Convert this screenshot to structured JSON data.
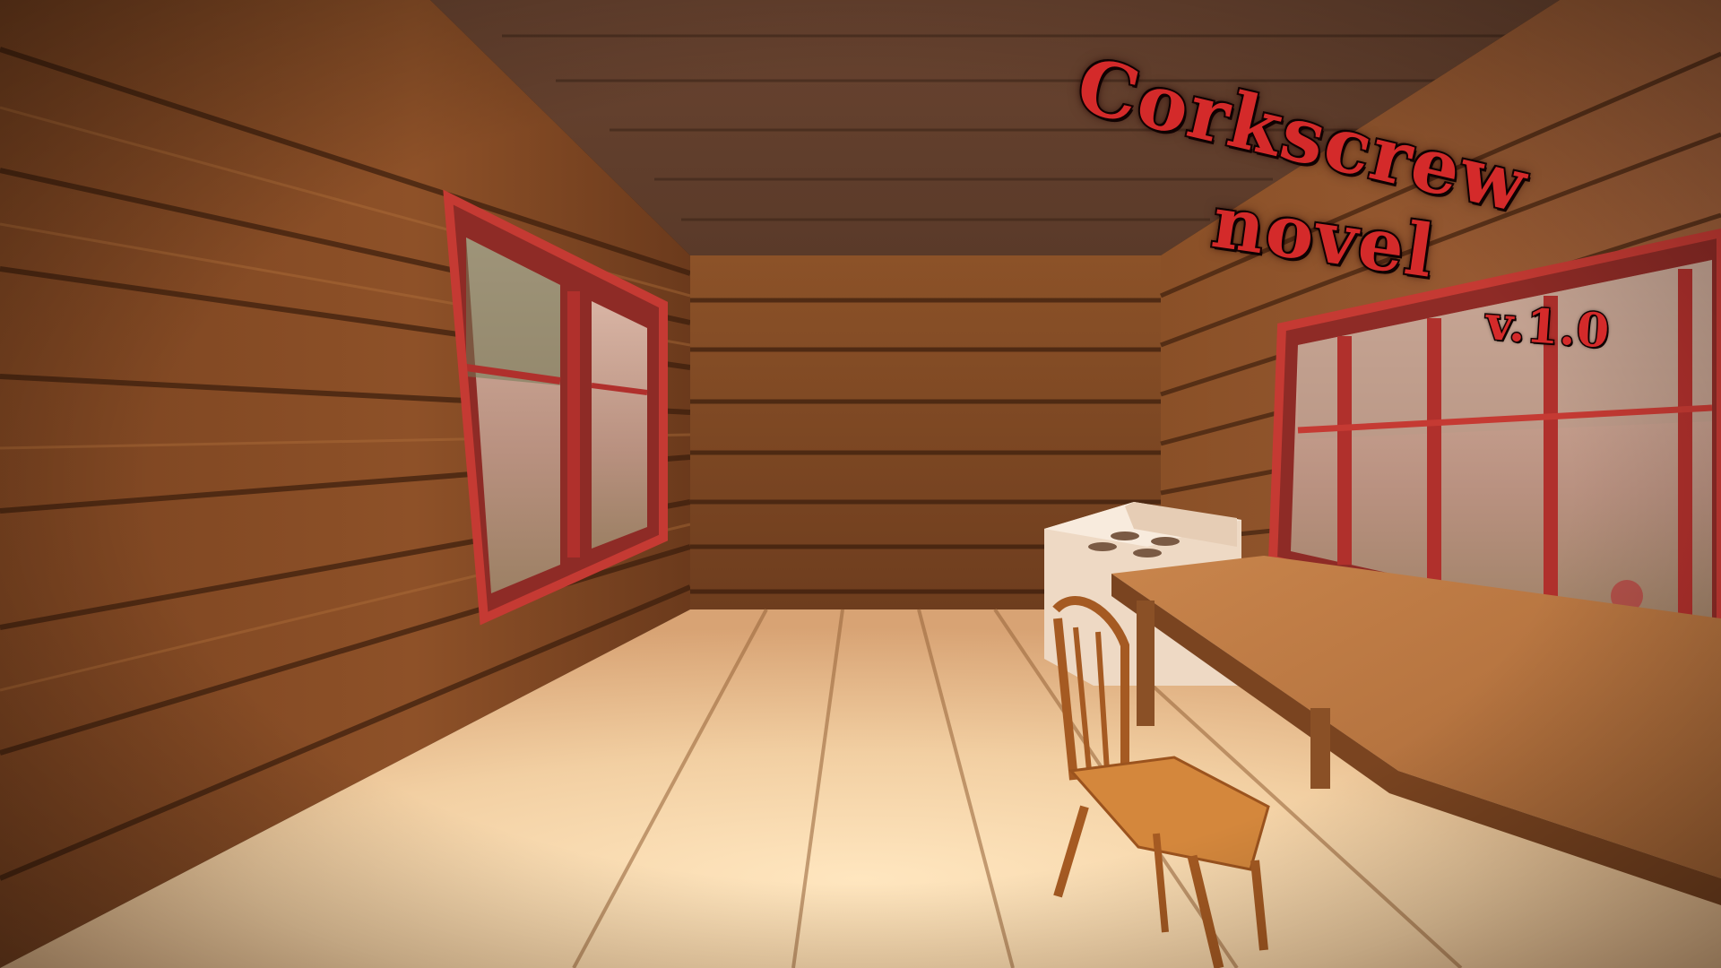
{
  "title": {
    "line1": "Corkscrew",
    "line2": "novel",
    "version": "v.1.0"
  },
  "colors": {
    "title_red": "#d42a2a",
    "title_outline": "#1a0505",
    "wood_dark": "#6b3a1c",
    "wood_light": "#b7743f",
    "window_frame": "#b0302c",
    "floor": "#f2cfa2"
  }
}
